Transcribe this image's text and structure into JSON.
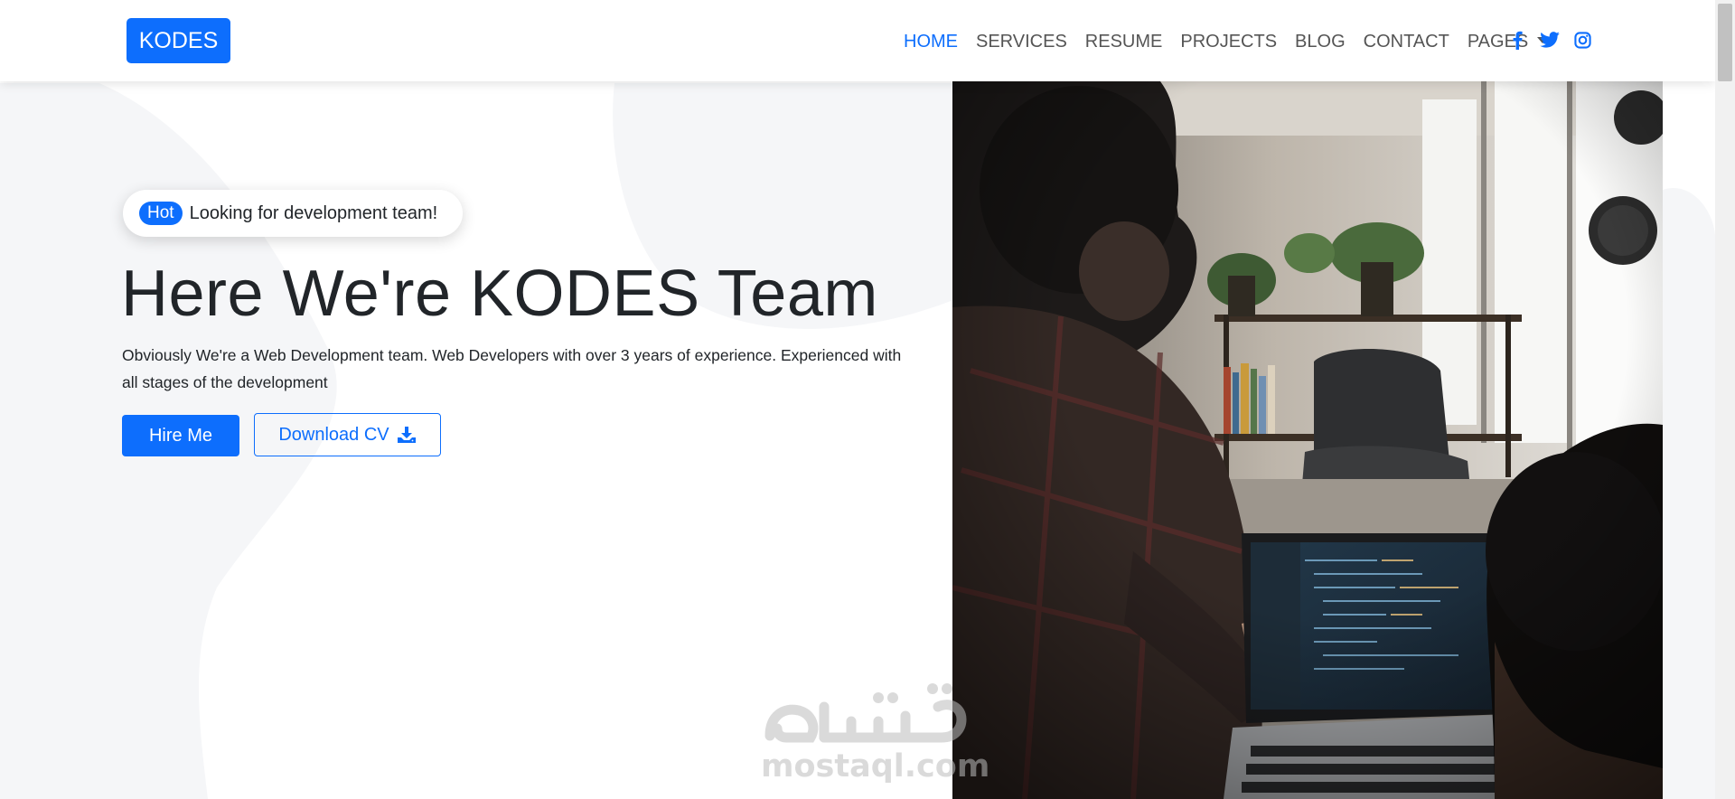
{
  "brand": {
    "label": "KODES"
  },
  "nav": {
    "items": [
      {
        "label": "HOME",
        "active": true
      },
      {
        "label": "SERVICES",
        "active": false
      },
      {
        "label": "RESUME",
        "active": false
      },
      {
        "label": "PROJECTS",
        "active": false
      },
      {
        "label": "BLOG",
        "active": false
      },
      {
        "label": "CONTACT",
        "active": false
      },
      {
        "label": "PAGES",
        "active": false,
        "dropdown": true
      }
    ],
    "socials": [
      "facebook-icon",
      "twitter-icon",
      "instagram-icon"
    ]
  },
  "hero": {
    "badge": "Hot",
    "pill_text": "Looking for development team!",
    "title": "Here We're KODES Team",
    "description": "Obviously We're a Web Development team. Web Developers with over 3 years of experience. Experienced with all stages of the development",
    "hire_label": "Hire Me",
    "cv_label": "Download CV"
  },
  "watermark": {
    "arabic": "مستقل",
    "latin": "mostaql.com"
  },
  "colors": {
    "accent": "#0d6efd",
    "text": "#212529",
    "nav_text": "#555555",
    "bg_blob": "#f5f6f8"
  }
}
